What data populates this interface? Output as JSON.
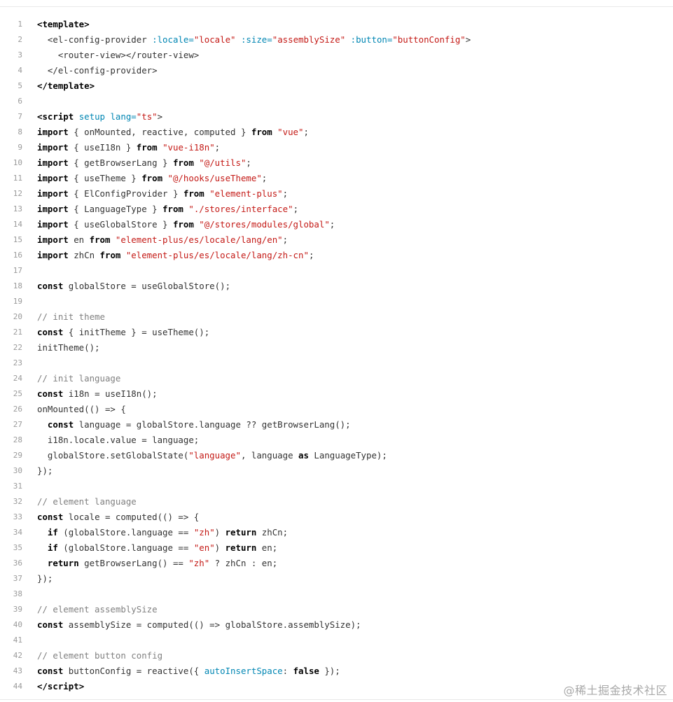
{
  "code_block": {
    "lines": [
      {
        "n": "1",
        "tokens": [
          {
            "t": "<",
            "c": "kw"
          },
          {
            "t": "template",
            "c": "kw"
          },
          {
            "t": ">",
            "c": "kw"
          }
        ]
      },
      {
        "n": "2",
        "tokens": [
          {
            "t": "  <el-config-provider ",
            "c": "plain"
          },
          {
            "t": ":locale=",
            "c": "attr"
          },
          {
            "t": "\"locale\"",
            "c": "str"
          },
          {
            "t": " ",
            "c": "plain"
          },
          {
            "t": ":size=",
            "c": "attr"
          },
          {
            "t": "\"assemblySize\"",
            "c": "str"
          },
          {
            "t": " ",
            "c": "plain"
          },
          {
            "t": ":button=",
            "c": "attr"
          },
          {
            "t": "\"buttonConfig\"",
            "c": "str"
          },
          {
            "t": ">",
            "c": "plain"
          }
        ]
      },
      {
        "n": "3",
        "tokens": [
          {
            "t": "    <router-view></router-view>",
            "c": "plain"
          }
        ]
      },
      {
        "n": "4",
        "tokens": [
          {
            "t": "  </el-config-provider>",
            "c": "plain"
          }
        ]
      },
      {
        "n": "5",
        "tokens": [
          {
            "t": "</",
            "c": "kw"
          },
          {
            "t": "template",
            "c": "kw"
          },
          {
            "t": ">",
            "c": "kw"
          }
        ]
      },
      {
        "n": "6",
        "tokens": []
      },
      {
        "n": "7",
        "tokens": [
          {
            "t": "<script ",
            "c": "kw"
          },
          {
            "t": "setup",
            "c": "attr"
          },
          {
            "t": " ",
            "c": "plain"
          },
          {
            "t": "lang=",
            "c": "attr"
          },
          {
            "t": "\"ts\"",
            "c": "str"
          },
          {
            "t": ">",
            "c": "plain"
          }
        ]
      },
      {
        "n": "8",
        "tokens": [
          {
            "t": "import",
            "c": "kw"
          },
          {
            "t": " { onMounted, reactive, computed } ",
            "c": "plain"
          },
          {
            "t": "from",
            "c": "kw"
          },
          {
            "t": " ",
            "c": "plain"
          },
          {
            "t": "\"vue\"",
            "c": "str"
          },
          {
            "t": ";",
            "c": "plain"
          }
        ]
      },
      {
        "n": "9",
        "tokens": [
          {
            "t": "import",
            "c": "kw"
          },
          {
            "t": " { useI18n } ",
            "c": "plain"
          },
          {
            "t": "from",
            "c": "kw"
          },
          {
            "t": " ",
            "c": "plain"
          },
          {
            "t": "\"vue-i18n\"",
            "c": "str"
          },
          {
            "t": ";",
            "c": "plain"
          }
        ]
      },
      {
        "n": "10",
        "tokens": [
          {
            "t": "import",
            "c": "kw"
          },
          {
            "t": " { getBrowserLang } ",
            "c": "plain"
          },
          {
            "t": "from",
            "c": "kw"
          },
          {
            "t": " ",
            "c": "plain"
          },
          {
            "t": "\"@/utils\"",
            "c": "str"
          },
          {
            "t": ";",
            "c": "plain"
          }
        ]
      },
      {
        "n": "11",
        "tokens": [
          {
            "t": "import",
            "c": "kw"
          },
          {
            "t": " { useTheme } ",
            "c": "plain"
          },
          {
            "t": "from",
            "c": "kw"
          },
          {
            "t": " ",
            "c": "plain"
          },
          {
            "t": "\"@/hooks/useTheme\"",
            "c": "str"
          },
          {
            "t": ";",
            "c": "plain"
          }
        ]
      },
      {
        "n": "12",
        "tokens": [
          {
            "t": "import",
            "c": "kw"
          },
          {
            "t": " { ElConfigProvider } ",
            "c": "plain"
          },
          {
            "t": "from",
            "c": "kw"
          },
          {
            "t": " ",
            "c": "plain"
          },
          {
            "t": "\"element-plus\"",
            "c": "str"
          },
          {
            "t": ";",
            "c": "plain"
          }
        ]
      },
      {
        "n": "13",
        "tokens": [
          {
            "t": "import",
            "c": "kw"
          },
          {
            "t": " { LanguageType } ",
            "c": "plain"
          },
          {
            "t": "from",
            "c": "kw"
          },
          {
            "t": " ",
            "c": "plain"
          },
          {
            "t": "\"./stores/interface\"",
            "c": "str"
          },
          {
            "t": ";",
            "c": "plain"
          }
        ]
      },
      {
        "n": "14",
        "tokens": [
          {
            "t": "import",
            "c": "kw"
          },
          {
            "t": " { useGlobalStore } ",
            "c": "plain"
          },
          {
            "t": "from",
            "c": "kw"
          },
          {
            "t": " ",
            "c": "plain"
          },
          {
            "t": "\"@/stores/modules/global\"",
            "c": "str"
          },
          {
            "t": ";",
            "c": "plain"
          }
        ]
      },
      {
        "n": "15",
        "tokens": [
          {
            "t": "import",
            "c": "kw"
          },
          {
            "t": " en ",
            "c": "plain"
          },
          {
            "t": "from",
            "c": "kw"
          },
          {
            "t": " ",
            "c": "plain"
          },
          {
            "t": "\"element-plus/es/locale/lang/en\"",
            "c": "str"
          },
          {
            "t": ";",
            "c": "plain"
          }
        ]
      },
      {
        "n": "16",
        "tokens": [
          {
            "t": "import",
            "c": "kw"
          },
          {
            "t": " zhCn ",
            "c": "plain"
          },
          {
            "t": "from",
            "c": "kw"
          },
          {
            "t": " ",
            "c": "plain"
          },
          {
            "t": "\"element-plus/es/locale/lang/zh-cn\"",
            "c": "str"
          },
          {
            "t": ";",
            "c": "plain"
          }
        ]
      },
      {
        "n": "17",
        "tokens": []
      },
      {
        "n": "18",
        "tokens": [
          {
            "t": "const",
            "c": "kw"
          },
          {
            "t": " globalStore = useGlobalStore();",
            "c": "plain"
          }
        ]
      },
      {
        "n": "19",
        "tokens": []
      },
      {
        "n": "20",
        "tokens": [
          {
            "t": "// init theme",
            "c": "com"
          }
        ]
      },
      {
        "n": "21",
        "tokens": [
          {
            "t": "const",
            "c": "kw"
          },
          {
            "t": " { initTheme } = useTheme();",
            "c": "plain"
          }
        ]
      },
      {
        "n": "22",
        "tokens": [
          {
            "t": "initTheme();",
            "c": "plain"
          }
        ]
      },
      {
        "n": "23",
        "tokens": []
      },
      {
        "n": "24",
        "tokens": [
          {
            "t": "// init language",
            "c": "com"
          }
        ]
      },
      {
        "n": "25",
        "tokens": [
          {
            "t": "const",
            "c": "kw"
          },
          {
            "t": " i18n = useI18n();",
            "c": "plain"
          }
        ]
      },
      {
        "n": "26",
        "tokens": [
          {
            "t": "onMounted(() => {",
            "c": "plain"
          }
        ]
      },
      {
        "n": "27",
        "tokens": [
          {
            "t": "  ",
            "c": "plain"
          },
          {
            "t": "const",
            "c": "kw"
          },
          {
            "t": " language = globalStore.language ?? getBrowserLang();",
            "c": "plain"
          }
        ]
      },
      {
        "n": "28",
        "tokens": [
          {
            "t": "  i18n.locale.value = language;",
            "c": "plain"
          }
        ]
      },
      {
        "n": "29",
        "tokens": [
          {
            "t": "  globalStore.setGlobalState(",
            "c": "plain"
          },
          {
            "t": "\"language\"",
            "c": "str"
          },
          {
            "t": ", language ",
            "c": "plain"
          },
          {
            "t": "as",
            "c": "kw"
          },
          {
            "t": " LanguageType);",
            "c": "plain"
          }
        ]
      },
      {
        "n": "30",
        "tokens": [
          {
            "t": "});",
            "c": "plain"
          }
        ]
      },
      {
        "n": "31",
        "tokens": []
      },
      {
        "n": "32",
        "tokens": [
          {
            "t": "// element language",
            "c": "com"
          }
        ]
      },
      {
        "n": "33",
        "tokens": [
          {
            "t": "const",
            "c": "kw"
          },
          {
            "t": " locale = computed(() => {",
            "c": "plain"
          }
        ]
      },
      {
        "n": "34",
        "tokens": [
          {
            "t": "  ",
            "c": "plain"
          },
          {
            "t": "if",
            "c": "kw"
          },
          {
            "t": " (globalStore.language == ",
            "c": "plain"
          },
          {
            "t": "\"zh\"",
            "c": "str"
          },
          {
            "t": ") ",
            "c": "plain"
          },
          {
            "t": "return",
            "c": "kw"
          },
          {
            "t": " zhCn;",
            "c": "plain"
          }
        ]
      },
      {
        "n": "35",
        "tokens": [
          {
            "t": "  ",
            "c": "plain"
          },
          {
            "t": "if",
            "c": "kw"
          },
          {
            "t": " (globalStore.language == ",
            "c": "plain"
          },
          {
            "t": "\"en\"",
            "c": "str"
          },
          {
            "t": ") ",
            "c": "plain"
          },
          {
            "t": "return",
            "c": "kw"
          },
          {
            "t": " en;",
            "c": "plain"
          }
        ]
      },
      {
        "n": "36",
        "tokens": [
          {
            "t": "  ",
            "c": "plain"
          },
          {
            "t": "return",
            "c": "kw"
          },
          {
            "t": " getBrowserLang() == ",
            "c": "plain"
          },
          {
            "t": "\"zh\"",
            "c": "str"
          },
          {
            "t": " ? zhCn : en;",
            "c": "plain"
          }
        ]
      },
      {
        "n": "37",
        "tokens": [
          {
            "t": "});",
            "c": "plain"
          }
        ]
      },
      {
        "n": "38",
        "tokens": []
      },
      {
        "n": "39",
        "tokens": [
          {
            "t": "// element assemblySize",
            "c": "com"
          }
        ]
      },
      {
        "n": "40",
        "tokens": [
          {
            "t": "const",
            "c": "kw"
          },
          {
            "t": " assemblySize = computed(() => globalStore.assemblySize);",
            "c": "plain"
          }
        ]
      },
      {
        "n": "41",
        "tokens": []
      },
      {
        "n": "42",
        "tokens": [
          {
            "t": "// element button config",
            "c": "com"
          }
        ]
      },
      {
        "n": "43",
        "tokens": [
          {
            "t": "const",
            "c": "kw"
          },
          {
            "t": " buttonConfig = reactive({ ",
            "c": "plain"
          },
          {
            "t": "autoInsertSpace",
            "c": "attr"
          },
          {
            "t": ": ",
            "c": "plain"
          },
          {
            "t": "false",
            "c": "kw"
          },
          {
            "t": " });",
            "c": "plain"
          }
        ]
      },
      {
        "n": "44",
        "tokens": [
          {
            "t": "</",
            "c": "kw"
          },
          {
            "t": "script",
            "c": "kw"
          },
          {
            "t": ">",
            "c": "kw"
          }
        ]
      }
    ]
  },
  "watermark": "@稀土掘金技术社区",
  "colors": {
    "keyword": "#000000",
    "string": "#c41a16",
    "attribute": "#0086b3",
    "comment": "#808080",
    "line_number": "#9a9a9a"
  }
}
